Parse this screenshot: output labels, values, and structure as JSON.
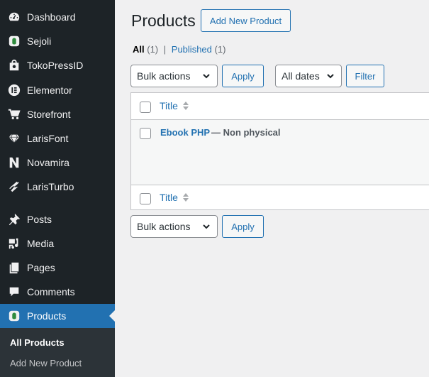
{
  "sidebar": {
    "items": [
      {
        "label": "Dashboard",
        "icon": "dashboard-icon"
      },
      {
        "label": "Sejoli",
        "icon": "sejoli-icon"
      },
      {
        "label": "TokoPressID",
        "icon": "bag-icon"
      },
      {
        "label": "Elementor",
        "icon": "elementor-icon"
      },
      {
        "label": "Storefront",
        "icon": "cart-icon"
      },
      {
        "label": "LarisFont",
        "icon": "diamond-icon"
      },
      {
        "label": "Novamira",
        "icon": "novamira-icon"
      },
      {
        "label": "LarisTurbo",
        "icon": "turbo-icon"
      },
      {
        "label": "Posts",
        "icon": "pin-icon"
      },
      {
        "label": "Media",
        "icon": "media-icon"
      },
      {
        "label": "Pages",
        "icon": "pages-icon"
      },
      {
        "label": "Comments",
        "icon": "comment-icon"
      },
      {
        "label": "Products",
        "icon": "products-icon"
      }
    ],
    "submenu": [
      {
        "label": "All Products"
      },
      {
        "label": "Add New Product"
      }
    ],
    "active_color": "#2271b1"
  },
  "header": {
    "title": "Products",
    "add_new": "Add New Product"
  },
  "views": {
    "all": "All",
    "all_count": "(1)",
    "separator": "|",
    "published": "Published",
    "published_count": "(1)"
  },
  "top_actions": {
    "bulk": "Bulk actions",
    "apply": "Apply",
    "dates": "All dates",
    "filter": "Filter"
  },
  "table": {
    "column_title": "Title",
    "rows": [
      {
        "title": "Ebook PHP",
        "state": "— Non physical"
      }
    ]
  },
  "bottom_actions": {
    "bulk": "Bulk actions",
    "apply": "Apply"
  }
}
